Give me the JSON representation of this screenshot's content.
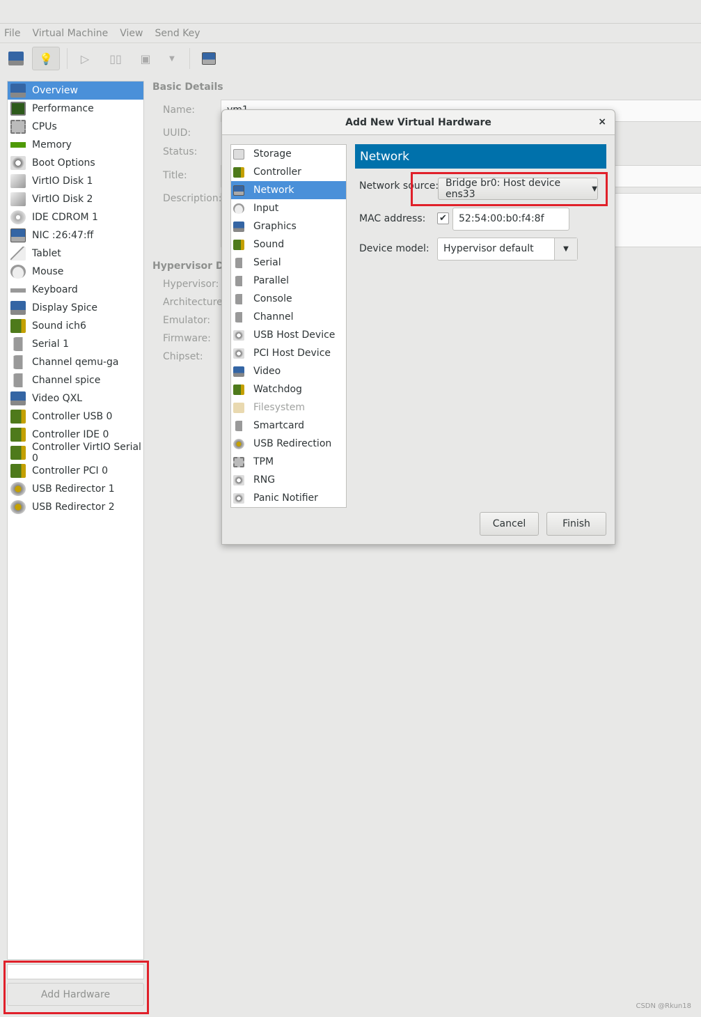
{
  "menu": [
    "File",
    "Virtual Machine",
    "View",
    "Send Key"
  ],
  "sidebar": {
    "selected": 0,
    "items": [
      {
        "label": "Overview",
        "icon": "mon"
      },
      {
        "label": "Performance",
        "icon": "perf"
      },
      {
        "label": "CPUs",
        "icon": "chip"
      },
      {
        "label": "Memory",
        "icon": "mem"
      },
      {
        "label": "Boot Options",
        "icon": "gear"
      },
      {
        "label": "VirtIO Disk 1",
        "icon": "disk"
      },
      {
        "label": "VirtIO Disk 2",
        "icon": "disk"
      },
      {
        "label": "IDE CDROM 1",
        "icon": "cd"
      },
      {
        "label": "NIC :26:47:ff",
        "icon": "net"
      },
      {
        "label": "Tablet",
        "icon": "tab"
      },
      {
        "label": "Mouse",
        "icon": "mouse"
      },
      {
        "label": "Keyboard",
        "icon": "kb"
      },
      {
        "label": "Display Spice",
        "icon": "mon"
      },
      {
        "label": "Sound ich6",
        "icon": "card"
      },
      {
        "label": "Serial 1",
        "icon": "ser"
      },
      {
        "label": "Channel qemu-ga",
        "icon": "ser"
      },
      {
        "label": "Channel spice",
        "icon": "ser"
      },
      {
        "label": "Video QXL",
        "icon": "mon"
      },
      {
        "label": "Controller USB 0",
        "icon": "card"
      },
      {
        "label": "Controller IDE 0",
        "icon": "card"
      },
      {
        "label": "Controller VirtIO Serial 0",
        "icon": "card"
      },
      {
        "label": "Controller PCI 0",
        "icon": "card"
      },
      {
        "label": "USB Redirector 1",
        "icon": "usb"
      },
      {
        "label": "USB Redirector 2",
        "icon": "usb"
      }
    ]
  },
  "add_hardware": "Add Hardware",
  "details": {
    "basic_heading": "Basic Details",
    "name_label": "Name:",
    "name_value": "vm1",
    "uuid_label": "UUID:",
    "status_label": "Status:",
    "title_label": "Title:",
    "description_label": "Description:",
    "hyper_heading": "Hypervisor Det",
    "hypervisor_label": "Hypervisor:",
    "arch_label": "Architecture:",
    "emulator_label": "Emulator:",
    "firmware_label": "Firmware:",
    "chipset_label": "Chipset:"
  },
  "dialog": {
    "title": "Add New Virtual Hardware",
    "close": "×",
    "selected": 2,
    "devices": [
      {
        "label": "Storage",
        "icon": "stor"
      },
      {
        "label": "Controller",
        "icon": "card"
      },
      {
        "label": "Network",
        "icon": "net"
      },
      {
        "label": "Input",
        "icon": "mouse"
      },
      {
        "label": "Graphics",
        "icon": "mon"
      },
      {
        "label": "Sound",
        "icon": "card"
      },
      {
        "label": "Serial",
        "icon": "ser"
      },
      {
        "label": "Parallel",
        "icon": "ser"
      },
      {
        "label": "Console",
        "icon": "ser"
      },
      {
        "label": "Channel",
        "icon": "ser"
      },
      {
        "label": "USB Host Device",
        "icon": "gear"
      },
      {
        "label": "PCI Host Device",
        "icon": "gear"
      },
      {
        "label": "Video",
        "icon": "mon"
      },
      {
        "label": "Watchdog",
        "icon": "card"
      },
      {
        "label": "Filesystem",
        "icon": "folder",
        "disabled": true
      },
      {
        "label": "Smartcard",
        "icon": "ser"
      },
      {
        "label": "USB Redirection",
        "icon": "usb"
      },
      {
        "label": "TPM",
        "icon": "chip"
      },
      {
        "label": "RNG",
        "icon": "gear"
      },
      {
        "label": "Panic Notifier",
        "icon": "gear"
      }
    ],
    "banner": "Network",
    "network_source_label": "Network source:",
    "network_source_value": "Bridge br0: Host device ens33",
    "mac_label": "MAC address:",
    "mac_checked": true,
    "mac_value": "52:54:00:b0:f4:8f",
    "model_label": "Device model:",
    "model_value": "Hypervisor default",
    "cancel": "Cancel",
    "finish": "Finish"
  },
  "watermark": "CSDN @Rkun18",
  "colors": {
    "selection": "#4a90d9",
    "banner": "#0071ab",
    "highlight": "#e0202a"
  }
}
